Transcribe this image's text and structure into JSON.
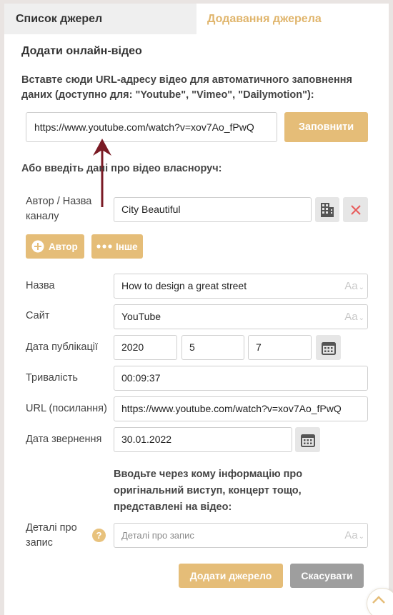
{
  "tabs": {
    "list": "Список джерел",
    "add": "Додавання джерела"
  },
  "form": {
    "title": "Додати онлайн-відео",
    "url_hint": "Вставте сюди URL-адресу відео для автоматичного заповнення даних (доступно для: \"Youtube\", \"Vimeo\", \"Dailymotion\"):",
    "url_value": "https://www.youtube.com/watch?v=xov7Ao_fPwQ",
    "fill_button": "Заповнити",
    "manual_hint": "Або введіть дані про відео власноруч:",
    "author_label": "Автор / Назва каналу",
    "author_value": "City Beautiful",
    "add_author_button": "Автор",
    "add_other_button": "Інше",
    "title_label": "Назва",
    "title_value": "How to design a great street",
    "site_label": "Сайт",
    "site_value": "YouTube",
    "pub_date_label": "Дата публікації",
    "pub_year": "2020",
    "pub_month": "5",
    "pub_day": "7",
    "duration_label": "Тривалість",
    "duration_value": "00:09:37",
    "url_label": "URL (посилання)",
    "url_field_value": "https://www.youtube.com/watch?v=xov7Ao_fPwQ",
    "access_date_label": "Дата звернення",
    "access_date_value": "30.01.2022",
    "details_hint": "Вводьте через кому інформацію про оригінальний виступ, концерт тощо, представлені на відео:",
    "details_label": "Деталі про запис",
    "details_placeholder": "Деталі про запис",
    "format_indicator": "Aa",
    "help_glyph": "?",
    "submit_button": "Додати джерело",
    "cancel_button": "Скасувати"
  },
  "colors": {
    "accent": "#e5bd78",
    "cancel": "#9e9e9e",
    "arrow": "#7a1a24"
  }
}
